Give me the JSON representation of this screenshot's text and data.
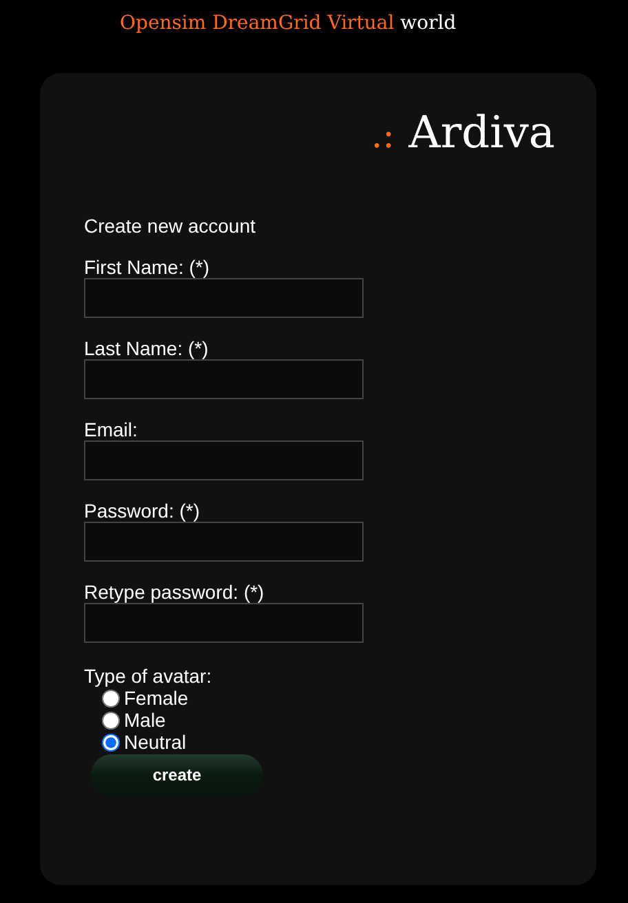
{
  "header": {
    "highlight": "Opensim DreamGrid Virtual",
    "rest": "world"
  },
  "logo": {
    "mark": ".:",
    "name": "Ardiva"
  },
  "form": {
    "title": "Create new account",
    "fields": [
      {
        "label": "First Name: (*)"
      },
      {
        "label": "Last Name: (*)"
      },
      {
        "label": "Email:"
      },
      {
        "label": "Password: (*)"
      },
      {
        "label": "Retype password: (*)"
      }
    ],
    "avatar_type": {
      "label": "Type of avatar:",
      "options": [
        {
          "label": "Female",
          "selected": false
        },
        {
          "label": "Male",
          "selected": false
        },
        {
          "label": "Neutral",
          "selected": true
        }
      ]
    },
    "submit": "create"
  }
}
